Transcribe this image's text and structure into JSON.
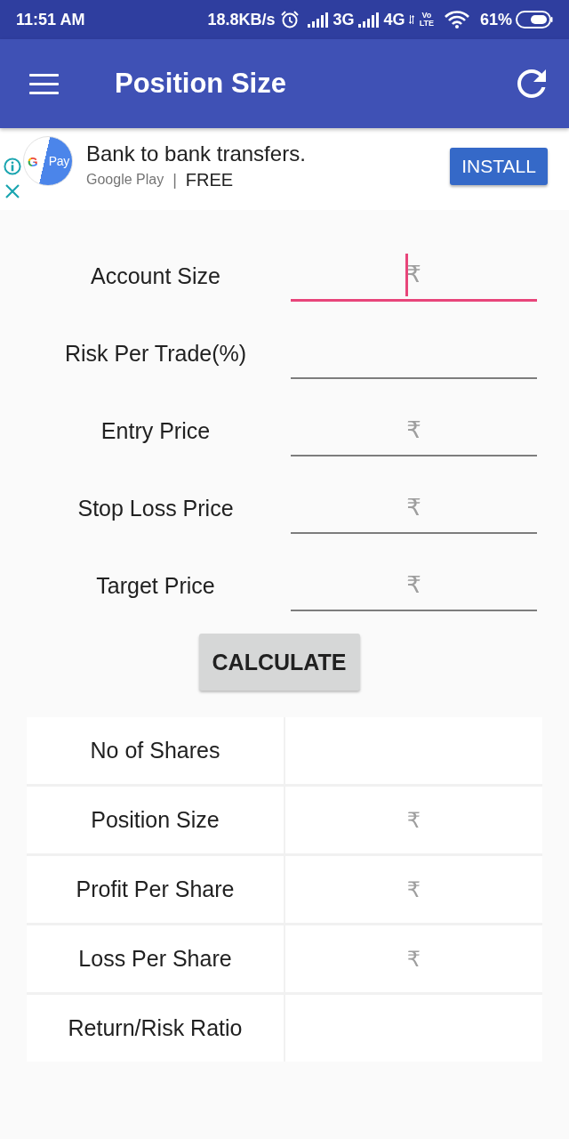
{
  "status_bar": {
    "time": "11:51 AM",
    "speed": "18.8KB/s",
    "network_1": "3G",
    "network_2": "4G",
    "volte": [
      "Vo",
      "LTE"
    ],
    "battery": "61%"
  },
  "app_bar": {
    "title": "Position Size"
  },
  "ad": {
    "logo": [
      "G",
      "Pay"
    ],
    "headline": "Bank to bank transfers.",
    "store": "Google Play",
    "separator": "|",
    "price": "FREE",
    "button": "INSTALL"
  },
  "form": {
    "fields": [
      {
        "label": "Account Size",
        "placeholder": "₹",
        "focused": true
      },
      {
        "label": "Risk Per Trade(%)",
        "focused": false
      },
      {
        "label": "Entry Price",
        "placeholder": "₹",
        "focused": false
      },
      {
        "label": "Stop Loss Price",
        "placeholder": "₹",
        "focused": false
      },
      {
        "label": "Target Price",
        "placeholder": "₹",
        "focused": false
      }
    ],
    "button": "CALCULATE"
  },
  "results": [
    {
      "label": "No of Shares"
    },
    {
      "label": "Position Size",
      "value": "₹"
    },
    {
      "label": "Profit Per Share",
      "value": "₹"
    },
    {
      "label": "Loss Per Share",
      "value": "₹"
    },
    {
      "label": "Return/Risk Ratio"
    }
  ]
}
